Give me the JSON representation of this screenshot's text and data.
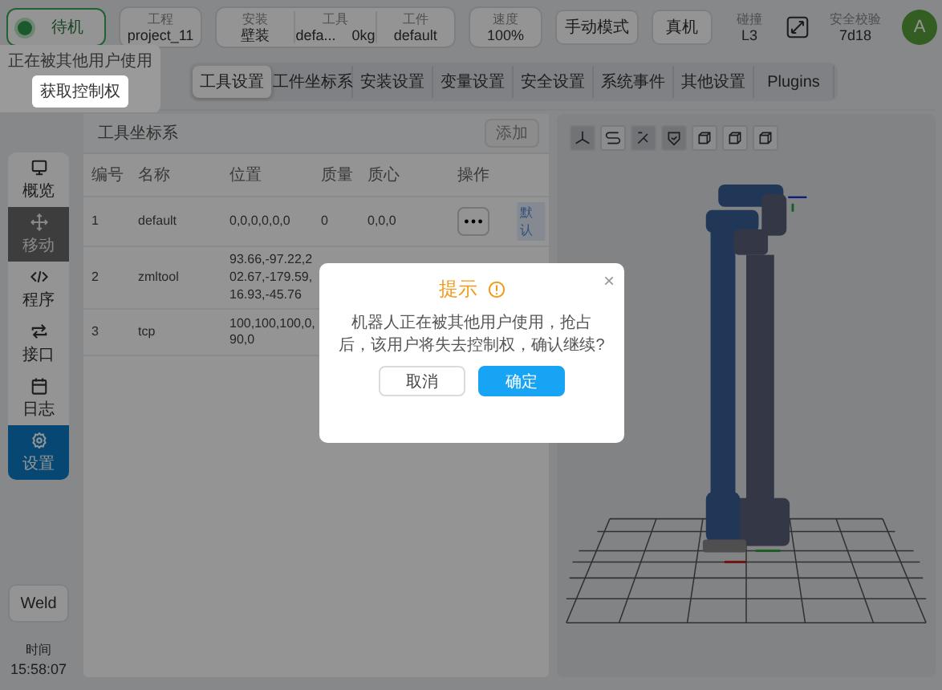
{
  "topbar": {
    "status": {
      "label": "待机"
    },
    "project": {
      "label": "工程",
      "value": "project_11"
    },
    "group": [
      {
        "label": "安装",
        "value": "壁装"
      },
      {
        "label": "工具",
        "value": "defa...",
        "extra": "0kg"
      },
      {
        "label": "工件",
        "value": "default"
      }
    ],
    "speed": {
      "label": "速度",
      "value": "100%"
    },
    "buttons": [
      "手动模式",
      "真机"
    ],
    "collision": {
      "label": "碰撞",
      "value": "L3"
    },
    "safety": {
      "label": "安全校验",
      "value": "7d18"
    },
    "avatar": "A"
  },
  "control_popover": {
    "message": "正在被其他用户使用",
    "button": "获取控制权"
  },
  "tabs": [
    {
      "label": "工具设置",
      "selected": true
    },
    {
      "label": "工件坐标系",
      "selected": false
    },
    {
      "label": "安装设置",
      "selected": false
    },
    {
      "label": "变量设置",
      "selected": false
    },
    {
      "label": "安全设置",
      "selected": false
    },
    {
      "label": "系统事件",
      "selected": false
    },
    {
      "label": "其他设置",
      "selected": false
    },
    {
      "label": "Plugins",
      "selected": false
    }
  ],
  "sidebar": {
    "items": [
      {
        "label": "概览",
        "selected": false,
        "hovered": false
      },
      {
        "label": "移动",
        "selected": false,
        "hovered": true
      },
      {
        "label": "程序",
        "selected": false,
        "hovered": false
      },
      {
        "label": "接口",
        "selected": false,
        "hovered": false
      },
      {
        "label": "日志",
        "selected": false,
        "hovered": false
      },
      {
        "label": "设置",
        "selected": true,
        "hovered": false
      }
    ],
    "mode_button": "Weld",
    "time_label": "时间",
    "time": "15:58:07"
  },
  "table_panel": {
    "title": "工具坐标系",
    "add_button": {
      "label": "添加",
      "disabled": true
    },
    "columns": [
      "编号",
      "名称",
      "位置",
      "质量",
      "质心",
      "操作"
    ],
    "rows": [
      {
        "cells": [
          "1",
          "default",
          "0,0,0,0,0,0",
          "0",
          "0,0,0"
        ],
        "badge": "默认"
      },
      {
        "cells": [
          "2",
          "zmltool",
          "93.66,-97.22,202.67,-179.59,16.93,-45.76"
        ]
      },
      {
        "cells": [
          "3",
          "tcp",
          "100,100,100,0,90,0"
        ]
      }
    ]
  },
  "view_toolbar": [
    {
      "selected": true
    },
    {
      "selected": false
    },
    {
      "selected": true
    },
    {
      "selected": true
    },
    {
      "selected": false
    },
    {
      "selected": false
    },
    {
      "selected": false
    }
  ],
  "dialog": {
    "title": "提示",
    "message": "机器人正在被其他用户使用，抢占后，该用户将失去控制权，确认继续?",
    "close": "×",
    "buttons": [
      {
        "label": "取消",
        "primary": false
      },
      {
        "label": "确定",
        "primary": true
      }
    ]
  }
}
